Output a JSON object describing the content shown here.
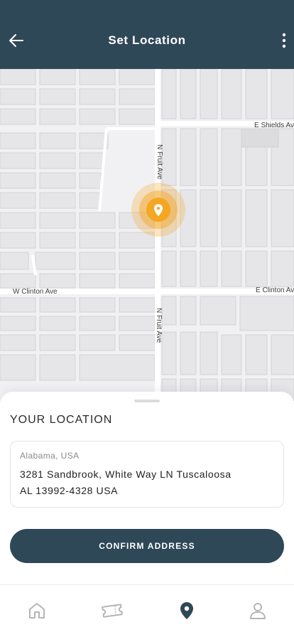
{
  "header": {
    "title": "Set Location",
    "back_icon": "arrow-left-icon",
    "more_icon": "more-vertical-icon"
  },
  "map": {
    "street_labels": {
      "e_shields": "E Shields Av",
      "n_fruit_top": "N Fruit Ave",
      "w_clinton": "W Clinton Ave",
      "e_clinton": "E Clinton Ave",
      "n_fruit_bottom": "N Fruit Ave"
    },
    "pin_icon": "location-pin-icon",
    "pin_color": "#f5a623"
  },
  "sheet": {
    "title": "YOUR LOCATION",
    "address": {
      "region": "Alabama, USA",
      "line1": "3281 Sandbrook, White Way LN Tuscaloosa",
      "line2": "AL 13992-4328 USA"
    },
    "confirm_label": "CONFIRM ADDRESS"
  },
  "tabbar": {
    "items": [
      {
        "icon": "home-icon",
        "active": false
      },
      {
        "icon": "ticket-icon",
        "active": false
      },
      {
        "icon": "location-pin-icon",
        "active": true
      },
      {
        "icon": "user-icon",
        "active": false
      }
    ]
  },
  "colors": {
    "primary": "#2f4858",
    "accent": "#f5a623",
    "inactive_icon": "#b5b5b5"
  }
}
